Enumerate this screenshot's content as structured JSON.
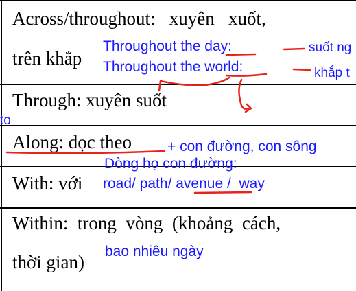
{
  "ink_colors": {
    "blue": "#1a1aff",
    "red": "#e8231c",
    "black": "#000000"
  },
  "rows": {
    "across": {
      "line1": "Across/throughout:   xuyên   xuốt,",
      "line2": "trên khắp"
    },
    "through": {
      "text": "Through: xuyên suốt"
    },
    "along": {
      "text": "Along: dọc theo"
    },
    "with": {
      "text": "With: với"
    },
    "within": {
      "line1": "Within:  trong  vòng  (khoảng  cách,",
      "line2": "thời gian)"
    }
  },
  "annotations": {
    "throughout_day": {
      "prefix": "Throughout the ",
      "word": "day",
      "suffix": ":"
    },
    "throughout_world": {
      "prefix": "Throughout the ",
      "word": "world",
      "suffix": ":"
    },
    "suot_ngay": "suốt ng",
    "khap_the_gioi": "khắp t",
    "to": "to",
    "along_plus": "+ con đường, con sông",
    "dong_ho": "Dòng họ con đường:",
    "with_road": {
      "prefix": "road/ path/ ",
      "word": "avenue",
      "suffix": " /  way"
    },
    "within_days": "bao nhiêu ngày"
  }
}
